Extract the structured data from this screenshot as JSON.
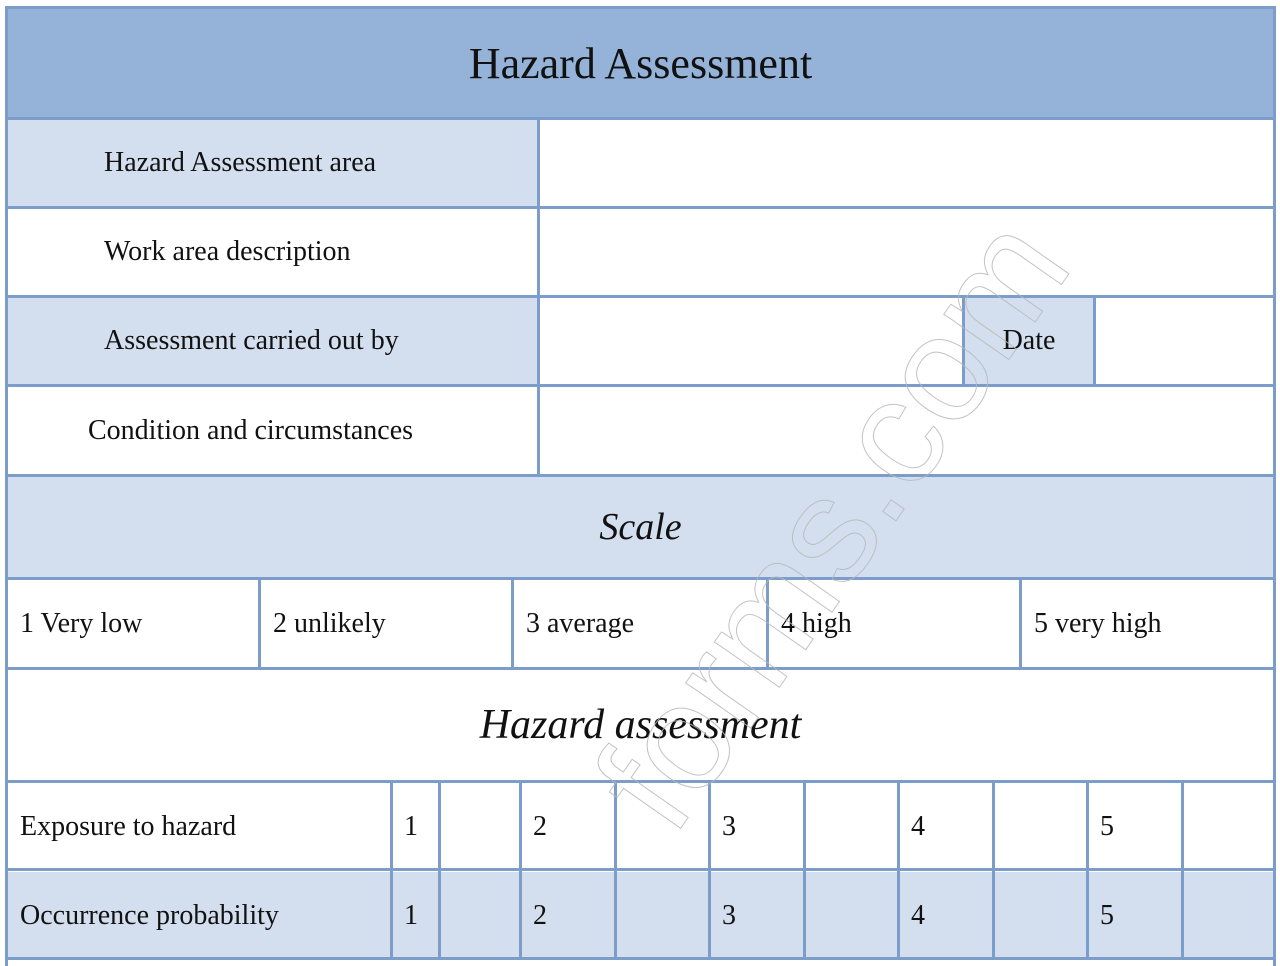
{
  "form": {
    "title": "Hazard Assessment",
    "fields": [
      {
        "label": "Hazard Assessment area",
        "value": ""
      },
      {
        "label": "Work area description",
        "value": ""
      },
      {
        "label": "Assessment carried out by",
        "value": ""
      },
      {
        "label": "Condition and circumstances",
        "value": ""
      }
    ],
    "date": {
      "label": "Date",
      "value": ""
    },
    "scale": {
      "heading": "Scale",
      "levels": [
        "1 Very low",
        "2 unlikely",
        "3 average",
        "4 high",
        "5 very high"
      ]
    },
    "assessment": {
      "heading": "Hazard assessment",
      "rows": [
        {
          "label": "Exposure to hazard",
          "options": [
            "1",
            "2",
            "3",
            "4",
            "5"
          ],
          "selected": null
        },
        {
          "label": "Occurrence probability",
          "options": [
            "1",
            "2",
            "3",
            "4",
            "5"
          ],
          "selected": null
        }
      ]
    }
  },
  "watermark": "forms.com",
  "colors": {
    "header_bg": "#95b3d9",
    "label_bg": "#d3dfee",
    "border": "#7c9cc9"
  }
}
